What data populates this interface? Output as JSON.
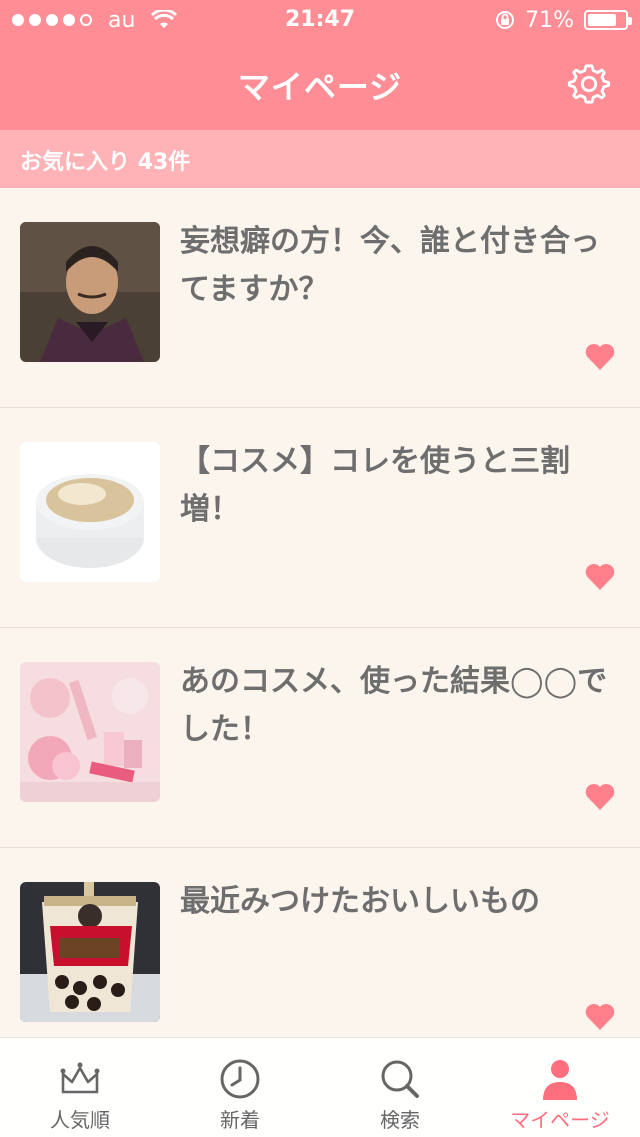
{
  "status_bar": {
    "carrier": "au",
    "time": "21:47",
    "battery": "71%"
  },
  "header": {
    "title": "マイページ"
  },
  "favorites": {
    "label": "お気に入り",
    "count_text": "43件"
  },
  "items": [
    {
      "title": "妄想癖の方！今、誰と付き合ってますか？",
      "thumb_icon": "portrait-photo"
    },
    {
      "title": "【コスメ】コレを使うと三割増！",
      "thumb_icon": "cosmetic-jar-photo"
    },
    {
      "title": "あのコスメ、使った結果◯◯でした！",
      "thumb_icon": "pink-cosmetics-photo"
    },
    {
      "title": "最近みつけたおいしいもの",
      "thumb_icon": "milk-tea-photo"
    }
  ],
  "tabs": [
    {
      "label": "人気順",
      "icon": "crown-icon"
    },
    {
      "label": "新着",
      "icon": "clock-icon"
    },
    {
      "label": "検索",
      "icon": "search-icon"
    },
    {
      "label": "マイページ",
      "icon": "user-icon"
    }
  ],
  "colors": {
    "accent": "#ff8d95",
    "subheader": "#ffb3b7",
    "heart": "#ff7f8a",
    "tab_active": "#ff6f7d",
    "background": "#fbf5ee"
  }
}
